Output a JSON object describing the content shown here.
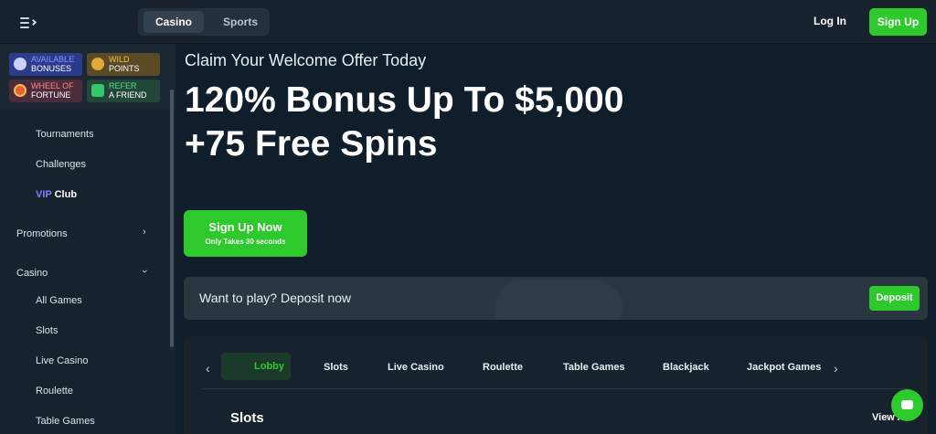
{
  "header": {
    "tabs": [
      {
        "label": "Casino",
        "active": true
      },
      {
        "label": "Sports",
        "active": false
      }
    ],
    "login_label": "Log In",
    "signup_label": "Sign Up"
  },
  "sidebar": {
    "tiles": [
      {
        "line1": "Available",
        "line2": "Bonuses",
        "icon": "gift-icon"
      },
      {
        "line1": "Wild",
        "line2": "Points",
        "icon": "coin-stack-icon"
      },
      {
        "line1": "Wheel of",
        "line2": "Fortune",
        "icon": "wheel-icon"
      },
      {
        "line1": "Refer",
        "line2": "a Friend",
        "icon": "megaphone-icon"
      }
    ],
    "items": {
      "tournaments": "Tournaments",
      "challenges": "Challenges",
      "vip_prefix": "VIP",
      "vip_suffix": "Club",
      "promotions": "Promotions",
      "casino": "Casino",
      "all_games": "All Games",
      "slots": "Slots",
      "live_casino": "Live Casino",
      "roulette": "Roulette",
      "table_games": "Table Games"
    }
  },
  "hero": {
    "kicker": "Claim Your Welcome Offer Today",
    "headline": "120% Bonus Up To $5,000 +75 Free Spins",
    "cta_label": "Sign Up Now",
    "cta_sub": "Only Takes 30 seconds"
  },
  "deposit": {
    "text": "Want to play? Deposit now",
    "button": "Deposit"
  },
  "games": {
    "tabs": [
      "Lobby",
      "Slots",
      "Live Casino",
      "Roulette",
      "Table Games",
      "Blackjack",
      "Jackpot Games"
    ],
    "section_title": "Slots",
    "view_all": "View All"
  },
  "colors": {
    "accent": "#2ec92d",
    "background": "#0f1e2a",
    "panel": "#17222d",
    "vip": "#8d7bff"
  }
}
